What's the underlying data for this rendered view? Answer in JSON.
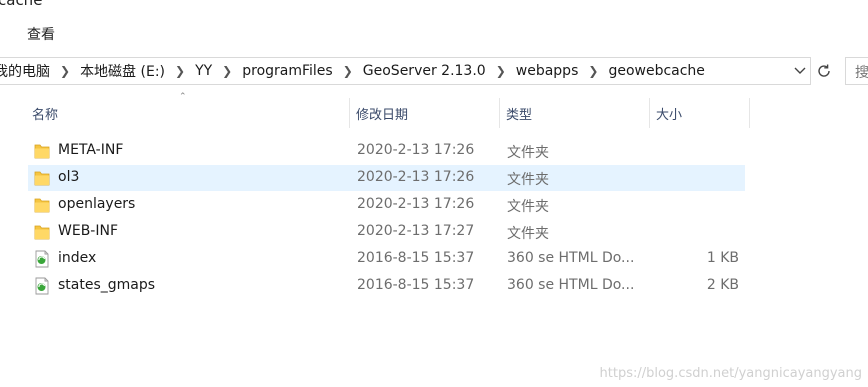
{
  "window": {
    "title_fragment": "cache"
  },
  "ribbon": {
    "view_tab": "查看"
  },
  "address_bar": {
    "breadcrumbs": [
      "我的电脑",
      "本地磁盘 (E:)",
      "YY",
      "programFiles",
      "GeoServer 2.13.0",
      "webapps",
      "geowebcache"
    ]
  },
  "search": {
    "placeholder": "搜"
  },
  "columns": {
    "name": "名称",
    "date": "修改日期",
    "type": "类型",
    "size": "大小"
  },
  "files": [
    {
      "name": "META-INF",
      "date": "2020-2-13 17:26",
      "type": "文件夹",
      "size": "",
      "icon": "folder-icon",
      "selected": false
    },
    {
      "name": "ol3",
      "date": "2020-2-13 17:26",
      "type": "文件夹",
      "size": "",
      "icon": "folder-icon",
      "selected": true
    },
    {
      "name": "openlayers",
      "date": "2020-2-13 17:26",
      "type": "文件夹",
      "size": "",
      "icon": "folder-icon",
      "selected": false
    },
    {
      "name": "WEB-INF",
      "date": "2020-2-13 17:27",
      "type": "文件夹",
      "size": "",
      "icon": "folder-icon",
      "selected": false
    },
    {
      "name": "index",
      "date": "2016-8-15 15:37",
      "type": "360 se HTML Do...",
      "size": "1 KB",
      "icon": "html-file-icon",
      "selected": false
    },
    {
      "name": "states_gmaps",
      "date": "2016-8-15 15:37",
      "type": "360 se HTML Do...",
      "size": "2 KB",
      "icon": "html-file-icon",
      "selected": false
    }
  ],
  "watermark": "https://blog.csdn.net/yangnicayangyang",
  "colors": {
    "selection": "#e5f3ff",
    "folder": "#f5c542",
    "header_text": "#3a4a6a"
  }
}
